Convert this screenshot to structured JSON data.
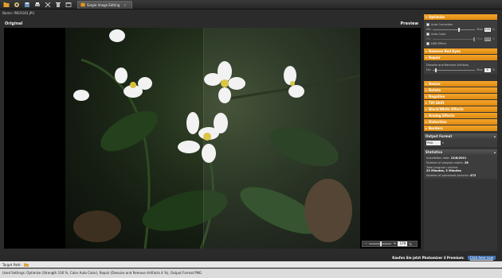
{
  "toolbar": {
    "tools": [
      "open-icon",
      "settings-icon",
      "save-icon",
      "print-icon",
      "cut-icon",
      "delete-icon",
      "window-icon"
    ],
    "tab_label": "Single Image Editing",
    "tab_close": "×"
  },
  "file": {
    "name_row": "Name: IMG9183.JPG"
  },
  "viewer": {
    "left_label": "Original",
    "right_label": "Preview",
    "zoom_value": "179"
  },
  "panel": {
    "optimize": {
      "title": "Optimize",
      "auto_correction": "Auto Correction",
      "min_label": "Min",
      "max_label": "Max",
      "strength_value": "100",
      "percent": "%",
      "auto_color": "Auto Color",
      "auto_color_value": "100",
      "hdr_effect": "HDR Effect"
    },
    "remove_red_eyes": "Remove Red Eyes",
    "repair": {
      "title": "Repair",
      "subtitle": "Denoise and Remove Artifacts",
      "min_label": "Min",
      "max_label": "Max",
      "value": "4",
      "percent": "%"
    },
    "sections": [
      "Resize",
      "Rotate",
      "Negative",
      "Tilt Shift",
      "Black/White Effects",
      "Analog Effects",
      "Distortion",
      "Borders"
    ],
    "output_format": {
      "title": "Output Format",
      "value": "PNG"
    },
    "statistics": {
      "title": "Statistics",
      "installation_date_label": "Installation date:",
      "installation_date": "13/6/2021",
      "starts_label": "Number of program starts:",
      "starts": "28",
      "runtime_label": "Total program runtime:",
      "runtime": "23 Minutes, 3 Minutes",
      "processed_label": "Number of processed pictures:",
      "processed": "472"
    }
  },
  "promo": {
    "text": "Kaufen Sie jetzt Photomizer 3 Premium:",
    "link": "Click here now"
  },
  "target": {
    "label": "Target Path:"
  },
  "status_text": "Used Settings: Optimize (Strength 100 %, Color Auto Color), Repair (Denoise and Remove Artifacts 4 %), Output Format PNG",
  "colors": {
    "accent": "#e8951a",
    "link": "#3f6fb0"
  }
}
